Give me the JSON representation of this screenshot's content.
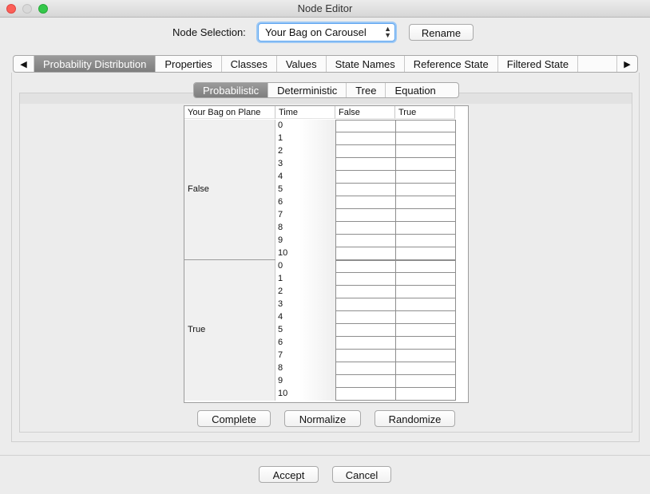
{
  "window": {
    "title": "Node Editor"
  },
  "node_selection": {
    "label": "Node Selection:",
    "value": "Your Bag on Carousel",
    "rename_label": "Rename"
  },
  "main_tabs": [
    {
      "label": "Probability Distribution",
      "active": true
    },
    {
      "label": "Properties",
      "active": false
    },
    {
      "label": "Classes",
      "active": false
    },
    {
      "label": "Values",
      "active": false
    },
    {
      "label": "State Names",
      "active": false
    },
    {
      "label": "Reference State",
      "active": false
    },
    {
      "label": "Filtered State",
      "active": false
    }
  ],
  "sub_tabs": [
    {
      "label": "Probabilistic",
      "active": true
    },
    {
      "label": "Deterministic",
      "active": false
    },
    {
      "label": "Tree",
      "active": false
    },
    {
      "label": "Equation",
      "active": false
    }
  ],
  "table": {
    "headers": [
      "Your Bag on Plane",
      "Time",
      "False",
      "True"
    ],
    "groups": [
      {
        "label": "False",
        "times": [
          "0",
          "1",
          "2",
          "3",
          "4",
          "5",
          "6",
          "7",
          "8",
          "9",
          "10"
        ]
      },
      {
        "label": "True",
        "times": [
          "0",
          "1",
          "2",
          "3",
          "4",
          "5",
          "6",
          "7",
          "8",
          "9",
          "10"
        ]
      }
    ]
  },
  "actions": {
    "complete": "Complete",
    "normalize": "Normalize",
    "randomize": "Randomize"
  },
  "footer": {
    "accept": "Accept",
    "cancel": "Cancel"
  },
  "icons": {
    "left_arrow": "left-arrow-icon",
    "right_arrow": "right-arrow-icon",
    "select_arrows": "updown-chevron-icon"
  }
}
